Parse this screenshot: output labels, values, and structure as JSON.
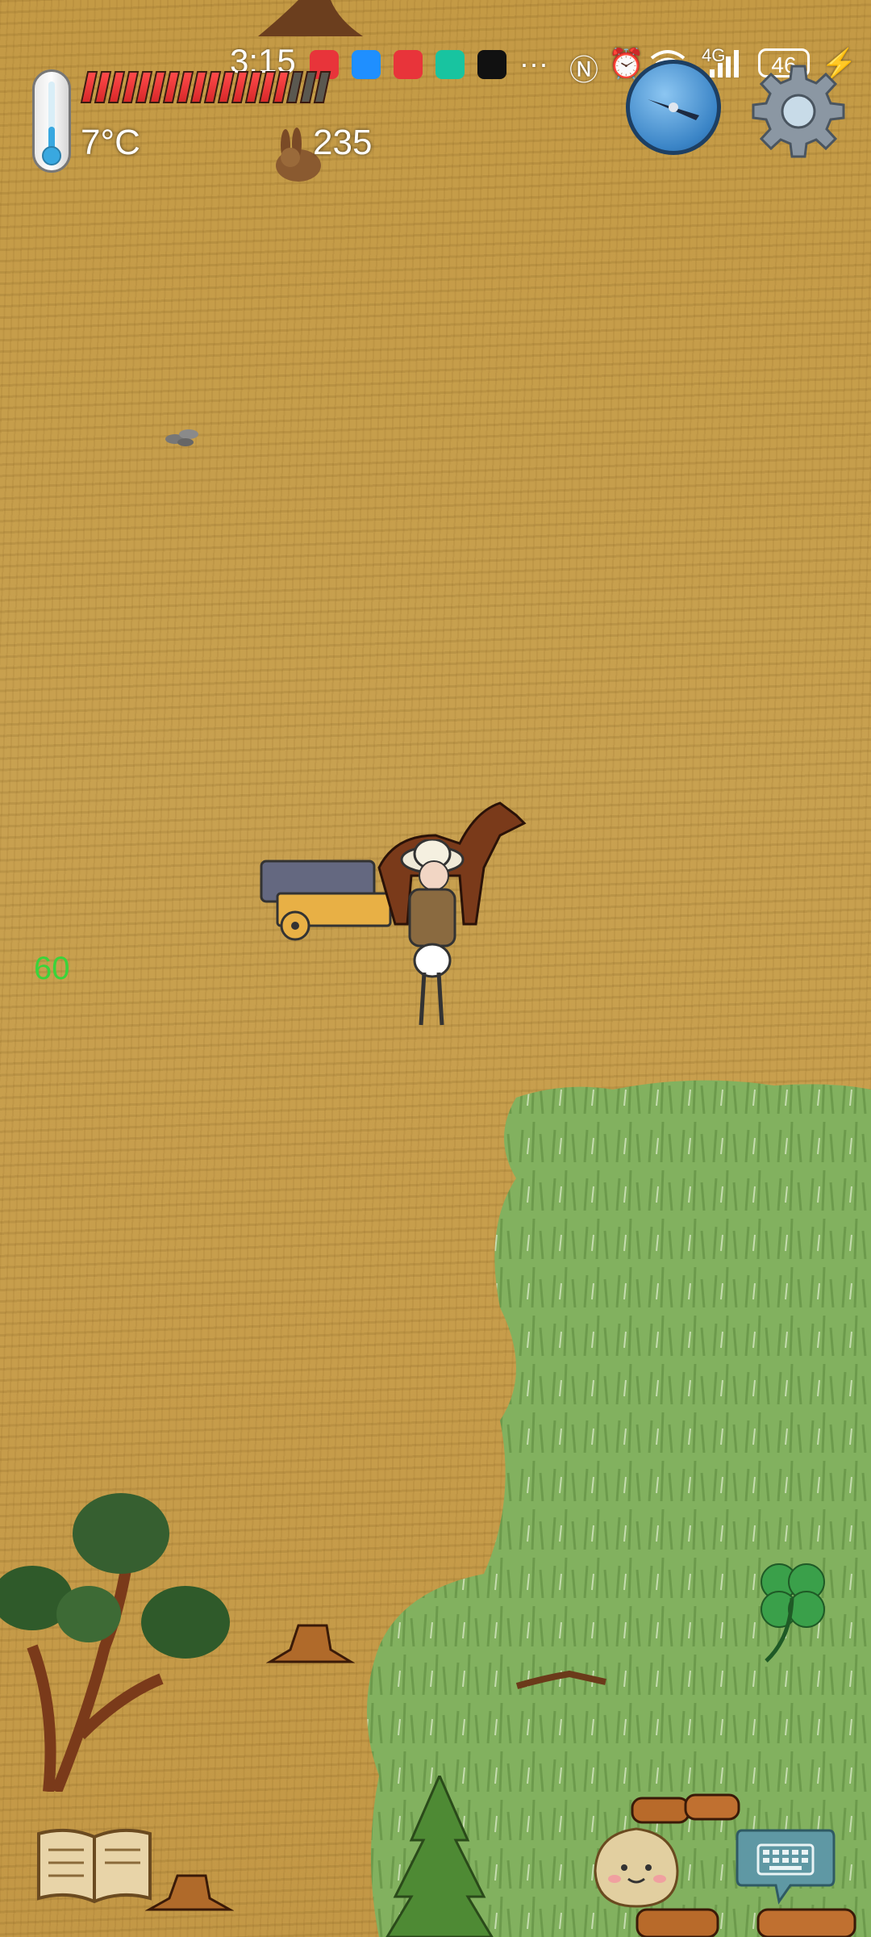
{
  "status_bar": {
    "time": "3:15",
    "network_label": "4G",
    "battery_level": "46",
    "more_glyph": "···"
  },
  "hud": {
    "temperature": "7°C",
    "yum_bonus": "235",
    "fps": "60",
    "food_pips_total": 18,
    "food_pips_filled": 15
  },
  "colors": {
    "ground": "#c49a45",
    "grass": "#7fae5a",
    "fps_text": "#3ad43a",
    "food_full": "#e03030"
  },
  "icons": {
    "thermometer": "thermometer-icon",
    "compass": "compass-icon",
    "settings": "gear-icon",
    "journal": "book-icon",
    "emote": "emote-face-icon",
    "keyboard": "keyboard-icon",
    "clover": "four-leaf-clover-icon"
  }
}
